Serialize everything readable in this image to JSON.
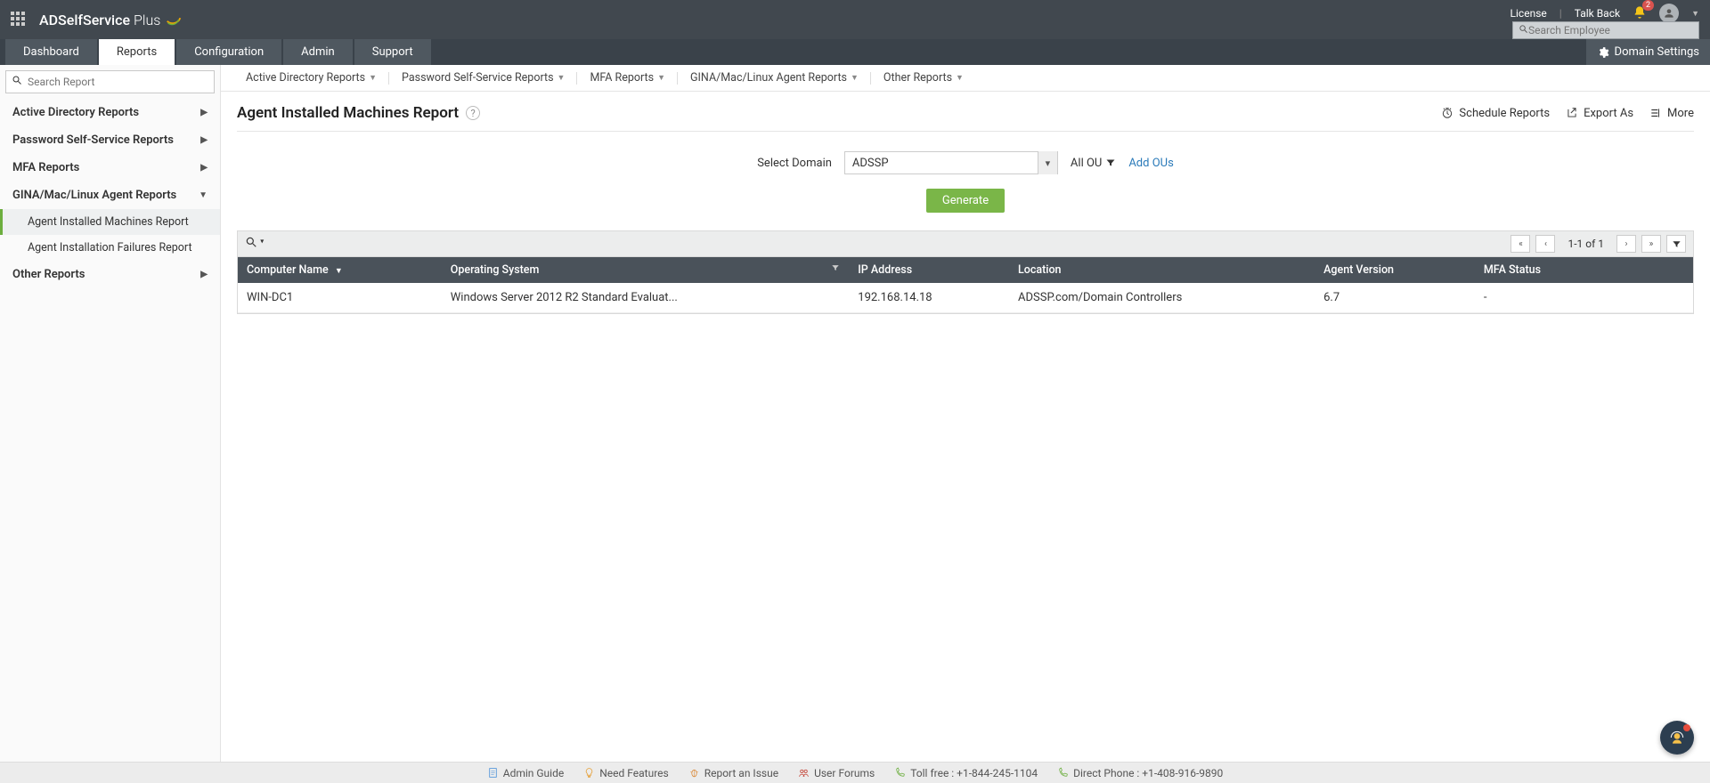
{
  "brand": {
    "name": "ADSelfService",
    "suffix": "Plus"
  },
  "topLinks": {
    "license": "License",
    "talkback": "Talk Back"
  },
  "notifications": {
    "count": "2"
  },
  "searchEmployee": {
    "placeholder": "Search Employee"
  },
  "nav": {
    "tabs": [
      "Dashboard",
      "Reports",
      "Configuration",
      "Admin",
      "Support"
    ],
    "domainSettings": "Domain Settings"
  },
  "sidebar": {
    "searchPlaceholder": "Search Report",
    "groups": {
      "adr": "Active Directory Reports",
      "pssr": "Password Self-Service Reports",
      "mfa": "MFA Reports",
      "gina": "GINA/Mac/Linux Agent Reports",
      "other": "Other Reports"
    },
    "ginaItems": {
      "installed": "Agent Installed Machines Report",
      "failures": "Agent Installation Failures Report"
    }
  },
  "subnav": {
    "adr": "Active Directory Reports",
    "pssr": "Password Self-Service Reports",
    "mfa": "MFA Reports",
    "gina": "GINA/Mac/Linux Agent Reports",
    "other": "Other Reports"
  },
  "page": {
    "title": "Agent Installed Machines Report",
    "actions": {
      "schedule": "Schedule Reports",
      "export": "Export As",
      "more": "More"
    }
  },
  "filters": {
    "selectDomainLabel": "Select Domain",
    "selectedDomain": "ADSSP",
    "allOU": "All OU",
    "addOUs": "Add OUs",
    "generate": "Generate"
  },
  "pager": {
    "text": "1-1 of 1"
  },
  "table": {
    "headers": {
      "computer": "Computer Name",
      "os": "Operating System",
      "ip": "IP Address",
      "location": "Location",
      "agentVersion": "Agent Version",
      "mfaStatus": "MFA Status"
    },
    "rows": [
      {
        "computer": "WIN-DC1",
        "os": "Windows Server 2012 R2 Standard Evaluat...",
        "ip": "192.168.14.18",
        "location": "ADSSP.com/Domain Controllers",
        "agentVersion": "6.7",
        "mfaStatus": "-"
      }
    ]
  },
  "footer": {
    "adminGuide": "Admin Guide",
    "needFeatures": "Need Features",
    "reportIssue": "Report an Issue",
    "userForums": "User Forums",
    "tollFree": "Toll free : +1-844-245-1104",
    "directPhone": "Direct Phone : +1-408-916-9890"
  }
}
